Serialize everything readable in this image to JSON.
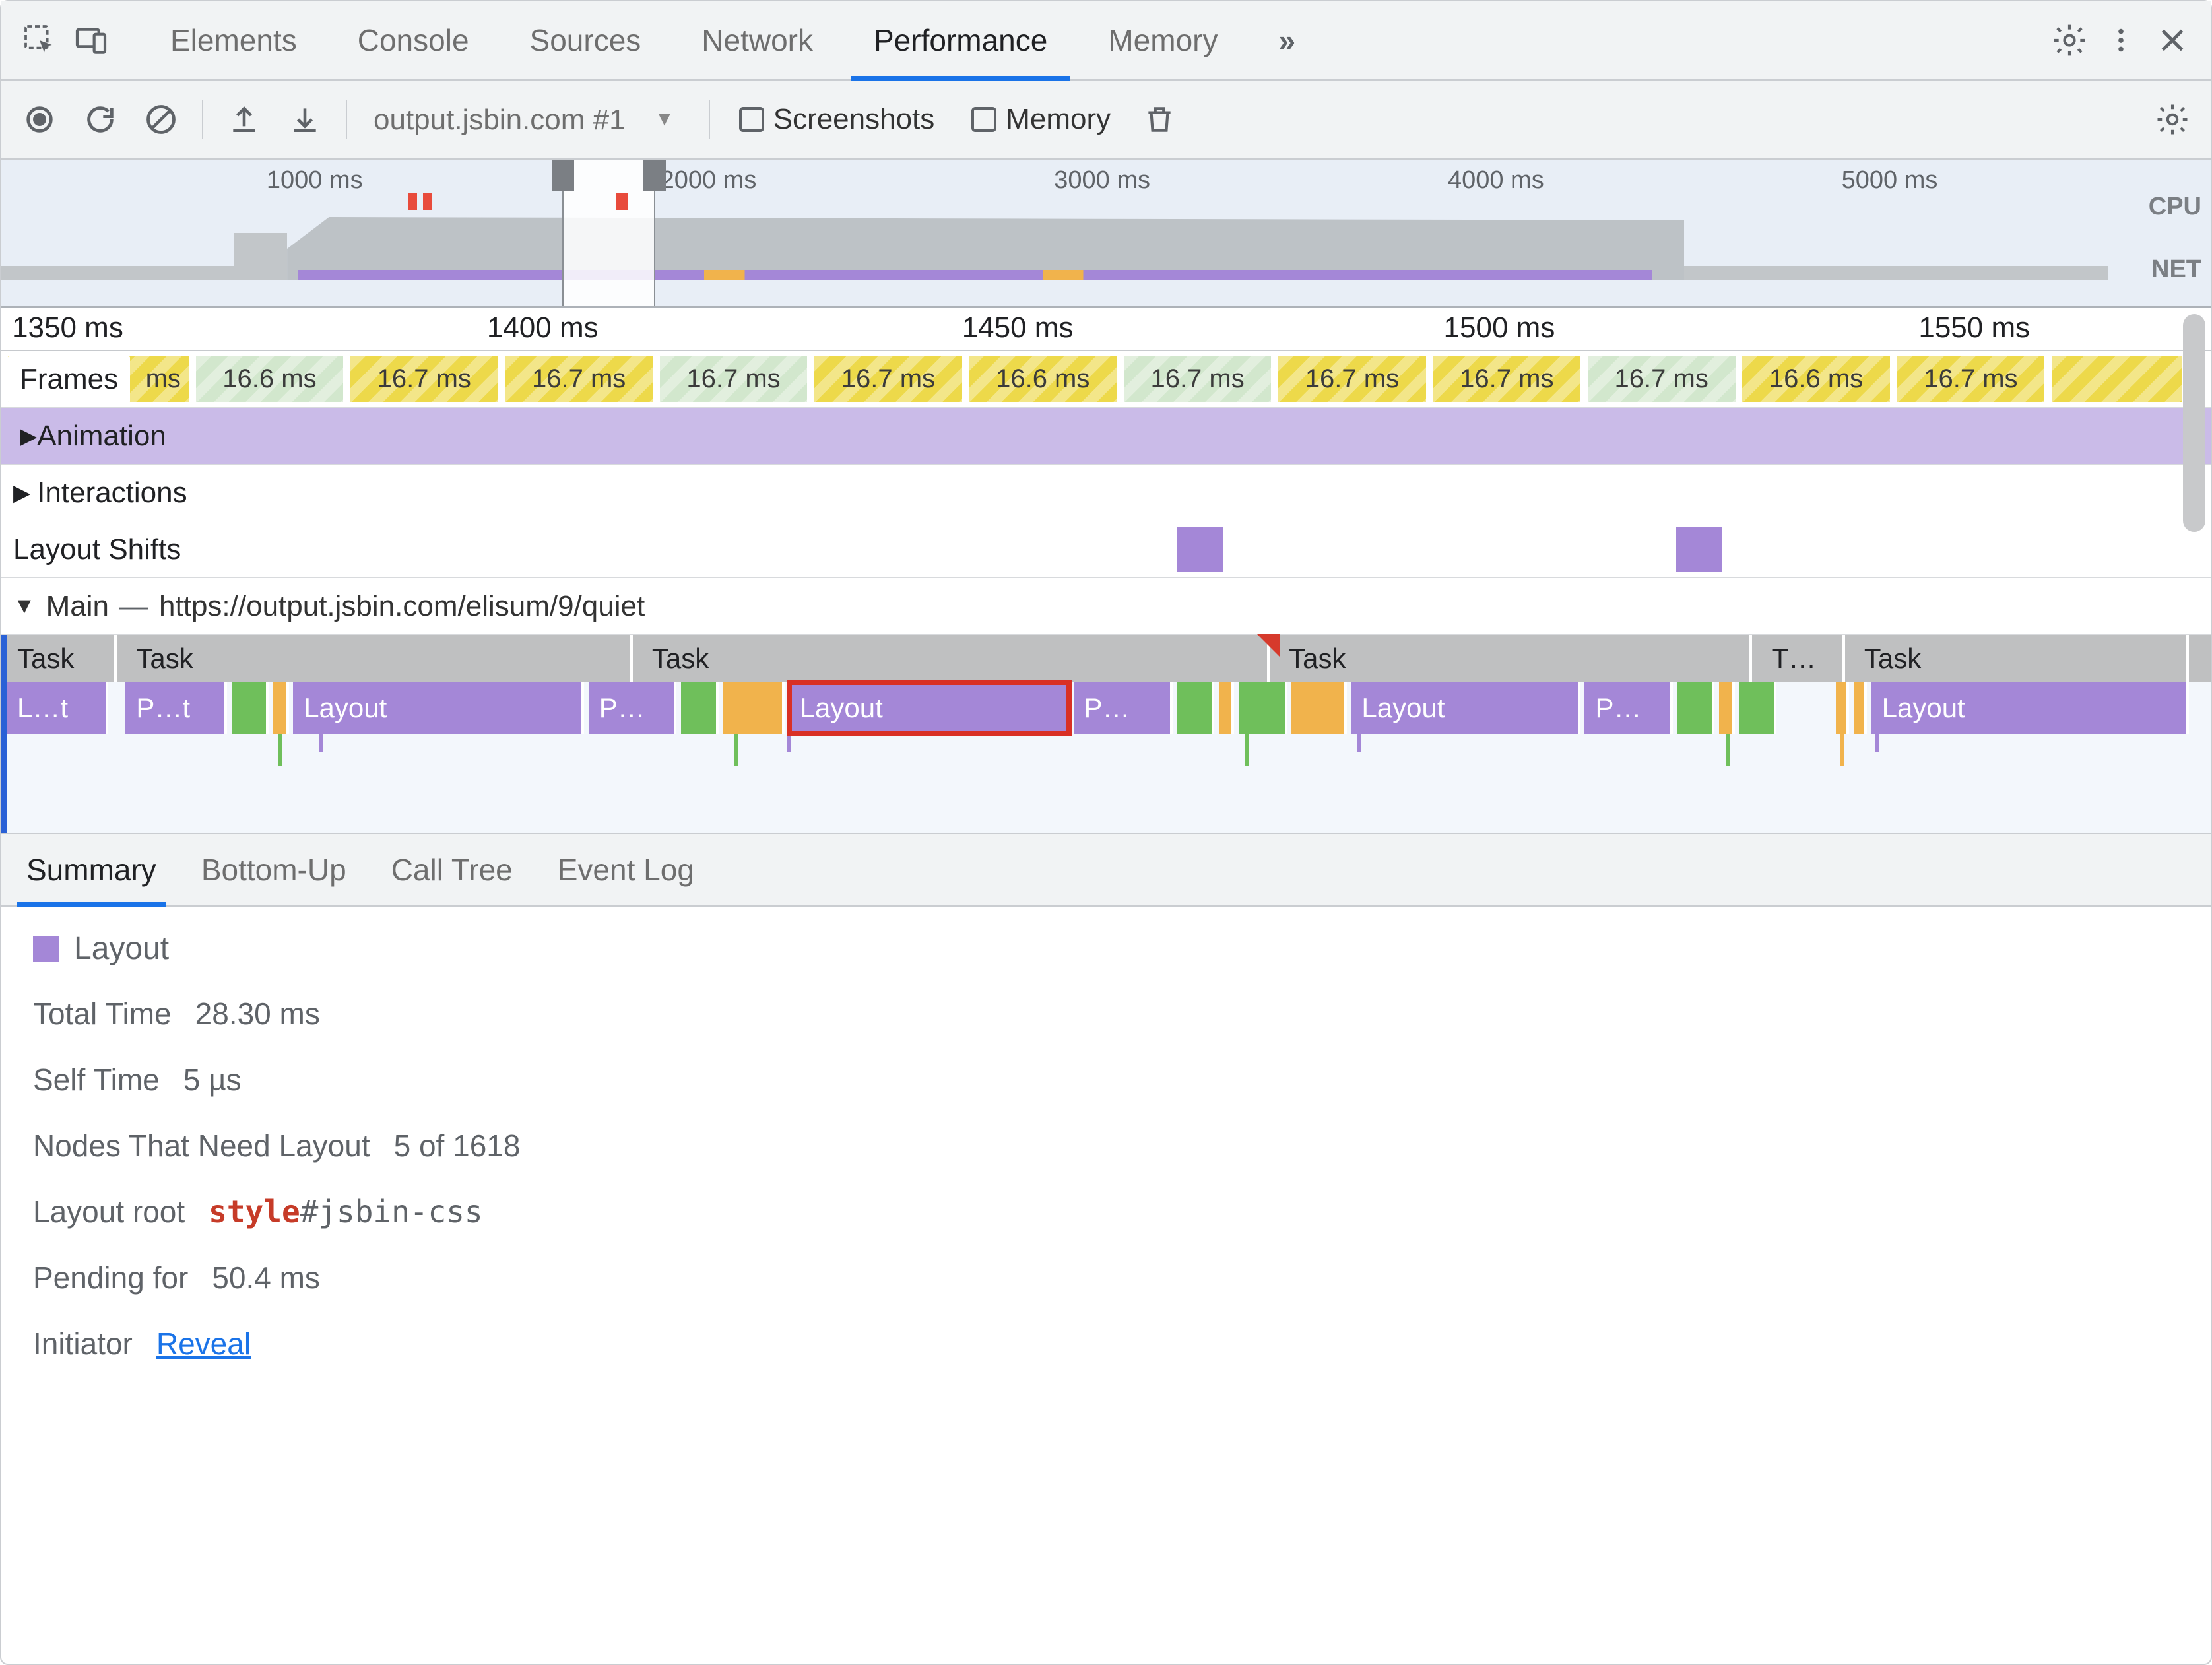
{
  "tabs": [
    "Elements",
    "Console",
    "Sources",
    "Network",
    "Performance",
    "Memory"
  ],
  "active_tab": "Performance",
  "session": {
    "recording_select": "output.jsbin.com #1",
    "checkboxes": {
      "screenshots": "Screenshots",
      "memory": "Memory"
    }
  },
  "overview": {
    "ticks": [
      "1000 ms",
      "2000 ms",
      "3000 ms",
      "4000 ms",
      "5000 ms"
    ],
    "labels": {
      "cpu": "CPU",
      "net": "NET"
    }
  },
  "flame": {
    "ruler_ticks": [
      "1350 ms",
      "1400 ms",
      "1450 ms",
      "1500 ms",
      "1550 ms"
    ],
    "frames": {
      "label": "Frames",
      "chips": [
        "ms",
        "16.6 ms",
        "16.7 ms",
        "16.7 ms",
        "16.7 ms",
        "16.7 ms",
        "16.6 ms",
        "16.7 ms",
        "16.7 ms",
        "16.7 ms",
        "16.7 ms",
        "16.6 ms",
        "16.7 ms"
      ]
    },
    "animation_label": "Animation",
    "interactions_label": "Interactions",
    "shifts_label": "Layout Shifts",
    "main": {
      "label": "Main",
      "url": "https://output.jsbin.com/elisum/9/quiet",
      "tasks": [
        "Task",
        "Task",
        "Task",
        "Task",
        "T…",
        "Task"
      ],
      "events": {
        "lt": "L…t",
        "pt": "P…t",
        "p": "P…",
        "layout": "Layout"
      }
    }
  },
  "bottom_tabs": [
    "Summary",
    "Bottom-Up",
    "Call Tree",
    "Event Log"
  ],
  "summary": {
    "title": "Layout",
    "rows": {
      "total_time_k": "Total Time",
      "total_time_v": "28.30 ms",
      "self_time_k": "Self Time",
      "self_time_v": "5 µs",
      "nodes_k": "Nodes That Need Layout",
      "nodes_v": "5 of 1618",
      "root_k": "Layout root",
      "root_tag": "style",
      "root_sel": "#jsbin-css",
      "pending_k": "Pending for",
      "pending_v": "50.4 ms",
      "initiator_k": "Initiator",
      "initiator_v": "Reveal"
    }
  }
}
